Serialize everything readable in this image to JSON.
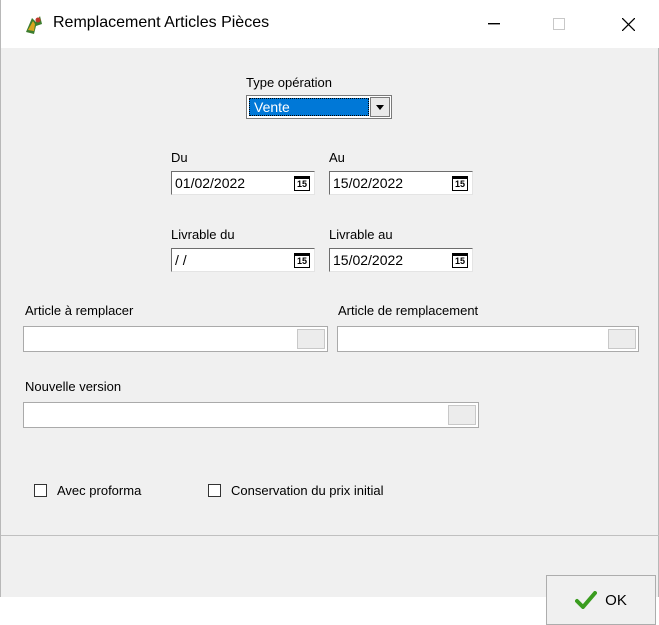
{
  "window": {
    "title": "Remplacement Articles Pièces",
    "controls": {
      "minimize": "—",
      "maximize": "☐",
      "close": "✕"
    }
  },
  "form": {
    "type_operation": {
      "label": "Type opération",
      "value": "Vente"
    },
    "du": {
      "label": "Du",
      "value": "01/02/2022"
    },
    "au": {
      "label": "Au",
      "value": "15/02/2022"
    },
    "livrable_du": {
      "label": "Livrable du",
      "value": " / /"
    },
    "livrable_au": {
      "label": "Livrable au",
      "value": "15/02/2022"
    },
    "calendar_badge": "15",
    "article_a_remplacer": {
      "label": "Article à remplacer",
      "value": ""
    },
    "article_de_remplacement": {
      "label": "Article de remplacement",
      "value": ""
    },
    "nouvelle_version": {
      "label": "Nouvelle version",
      "value": ""
    },
    "avec_proforma": {
      "label": "Avec proforma",
      "checked": false
    },
    "conservation_prix": {
      "label": "Conservation du prix initial",
      "checked": false
    }
  },
  "footer": {
    "ok_label": "OK"
  },
  "colors": {
    "selection": "#0078d7",
    "ok_check": "#3a9c1f"
  }
}
